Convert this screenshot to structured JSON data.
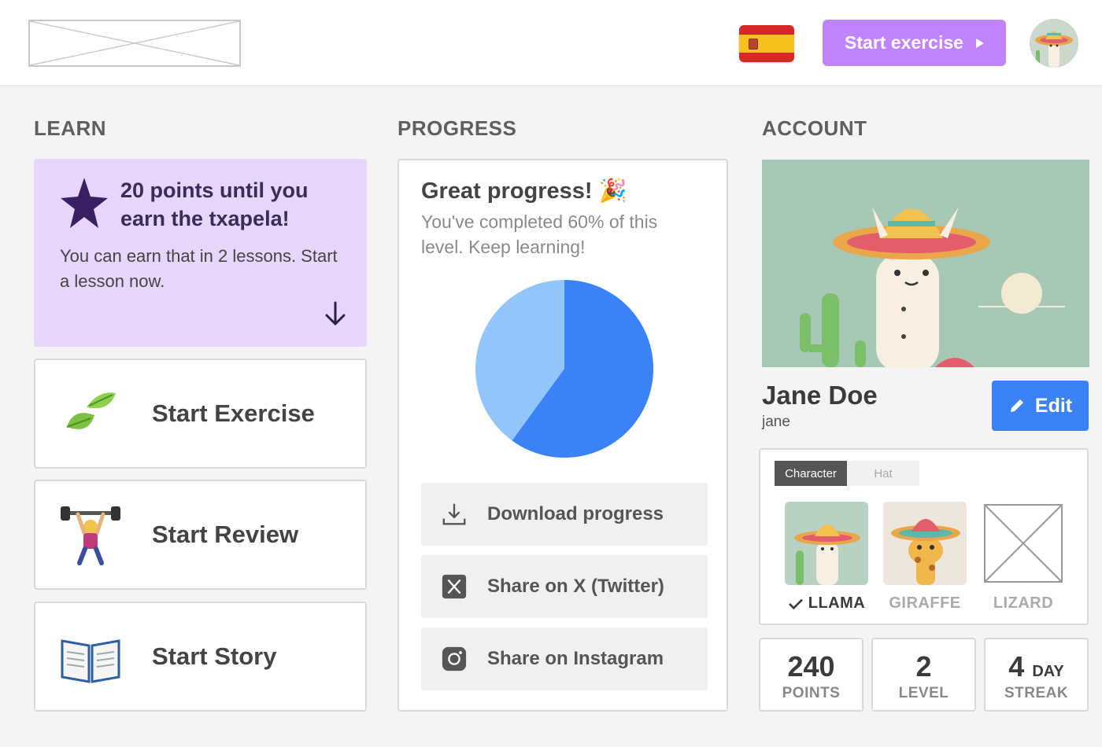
{
  "header": {
    "logo": "logo-placeholder",
    "language_flag": "spain-flag",
    "start_button_label": "Start exercise",
    "avatar": "llama-avatar"
  },
  "learn": {
    "title": "LEARN",
    "promo": {
      "headline": "20 points until you earn the txapela!",
      "body": "You can earn that in 2 lessons. Start a lesson now.",
      "icon": "star-icon"
    },
    "cards": [
      {
        "label": "Start Exercise",
        "icon": "leaves-icon"
      },
      {
        "label": "Start Review",
        "icon": "weightlifter-icon"
      },
      {
        "label": "Start Story",
        "icon": "open-book-icon"
      }
    ]
  },
  "progress": {
    "title": "PROGRESS",
    "headline": "Great progress! 🎉",
    "subtext": "You've completed 60% of this level. Keep learning!",
    "completed_fraction": 0.6,
    "colors": {
      "completed": "#3b82f6",
      "remaining": "#93c5fd"
    },
    "actions": [
      {
        "label": "Download progress",
        "icon": "download-icon"
      },
      {
        "label": "Share on X (Twitter)",
        "icon": "x-twitter-icon"
      },
      {
        "label": "Share on Instagram",
        "icon": "instagram-icon"
      }
    ]
  },
  "account": {
    "title": "ACCOUNT",
    "name": "Jane Doe",
    "username": "jane",
    "edit_label": "Edit",
    "tabs": [
      "Character",
      "Hat"
    ],
    "active_tab": "Character",
    "characters": [
      {
        "name": "LLAMA",
        "selected": true
      },
      {
        "name": "GIRAFFE",
        "selected": false
      },
      {
        "name": "LIZARD",
        "selected": false
      }
    ],
    "stats": [
      {
        "value": "240",
        "unit": "POINTS"
      },
      {
        "value": "2",
        "unit": "LEVEL"
      },
      {
        "value": "4",
        "unit_top": "DAY",
        "unit": "STREAK"
      }
    ]
  }
}
